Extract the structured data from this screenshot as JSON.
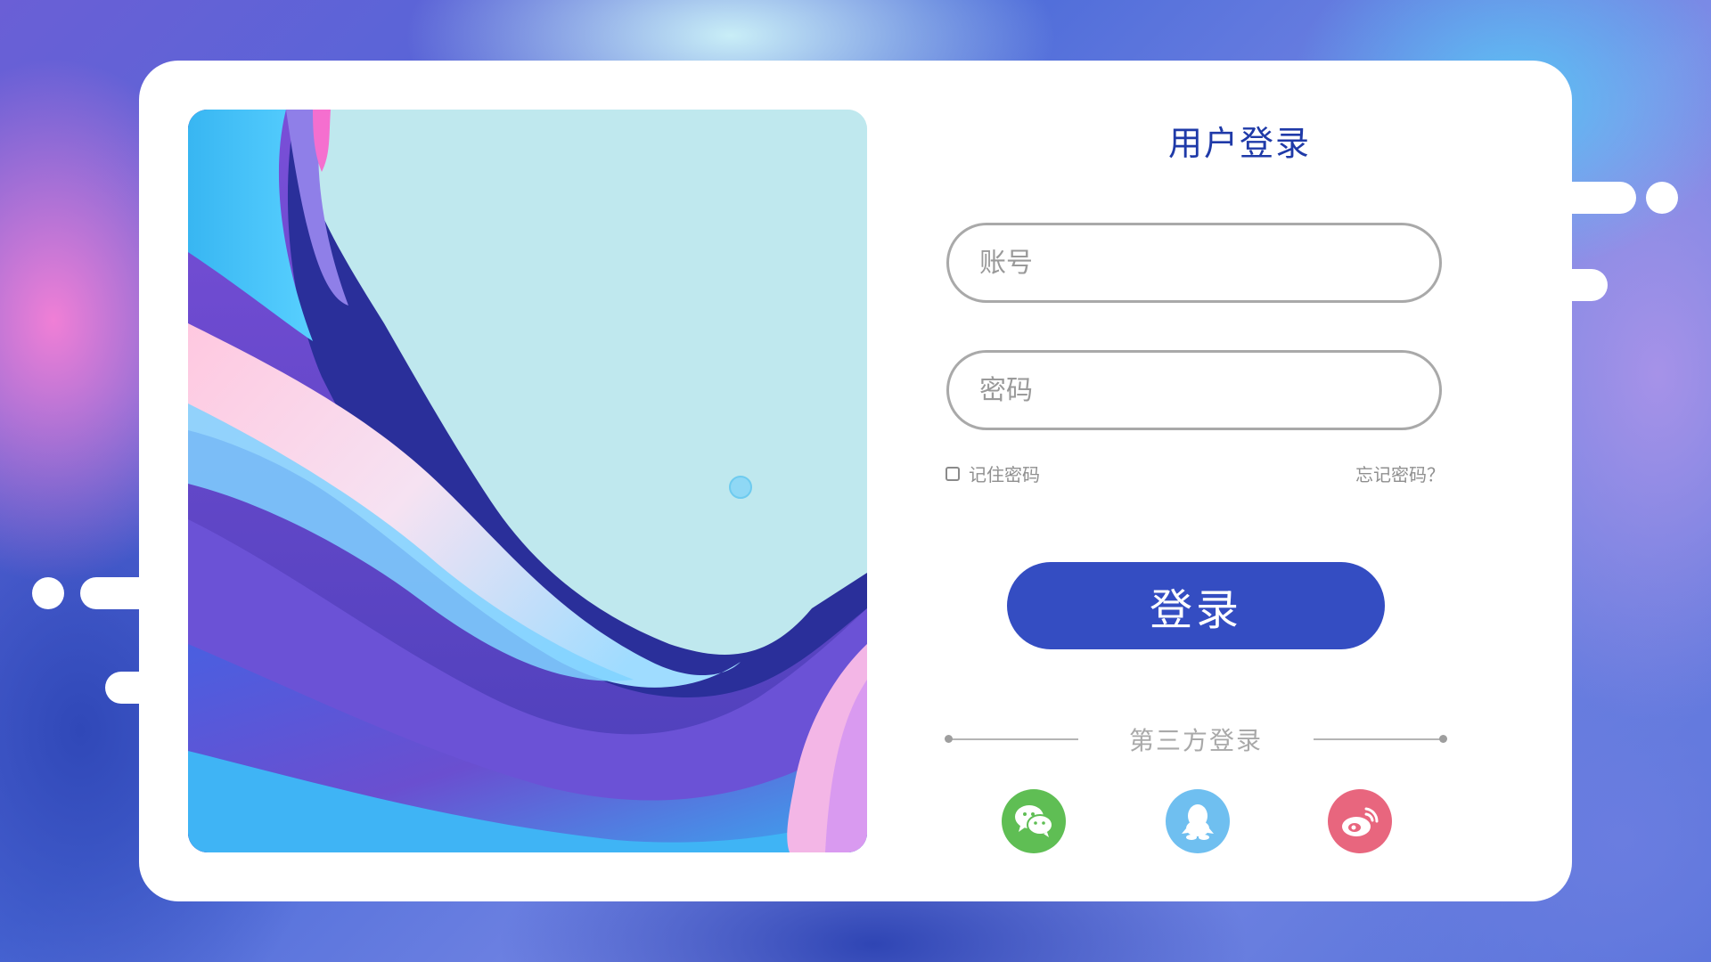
{
  "login": {
    "title": "用户登录",
    "account_placeholder": "账号",
    "password_placeholder": "密码",
    "remember_label": "记住密码",
    "forgot_label": "忘记密码？",
    "submit_label": "登录",
    "third_party_label": "第三方登录",
    "social": [
      {
        "name": "wechat",
        "icon": "wechat-icon",
        "color": "#5fbe54"
      },
      {
        "name": "qq",
        "icon": "qq-icon",
        "color": "#6fbff0"
      },
      {
        "name": "weibo",
        "icon": "weibo-icon",
        "color": "#e8667e"
      }
    ]
  },
  "colors": {
    "title": "#1f3aa8",
    "button": "#344dc2",
    "field_border": "#a9a9a9"
  }
}
